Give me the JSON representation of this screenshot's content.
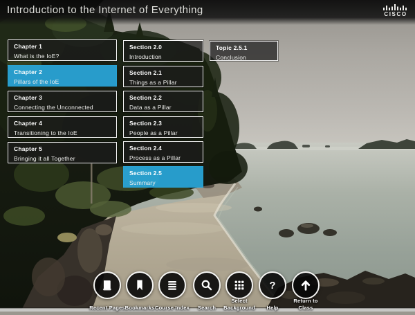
{
  "header": {
    "title": "Introduction to the Internet of Everything",
    "brand": "CISCO"
  },
  "course_menu": {
    "chapters": [
      {
        "label": "Chapter 1",
        "title": "What is the IoE?"
      },
      {
        "label": "Chapter 2",
        "title": "Pillars of the IoE"
      },
      {
        "label": "Chapter 3",
        "title": "Connecting the Unconnected"
      },
      {
        "label": "Chapter 4",
        "title": "Transitioning to the IoE"
      },
      {
        "label": "Chapter 5",
        "title": "Bringing it all Together"
      }
    ],
    "sections": [
      {
        "label": "Section 2.0",
        "title": "Introduction"
      },
      {
        "label": "Section 2.1",
        "title": "Things as a Pillar"
      },
      {
        "label": "Section 2.2",
        "title": "Data as a Pillar"
      },
      {
        "label": "Section 2.3",
        "title": "People as a Pillar"
      },
      {
        "label": "Section 2.4",
        "title": "Process as a Pillar"
      },
      {
        "label": "Section 2.5",
        "title": "Summary"
      }
    ],
    "topics": [
      {
        "label": "Topic 2.5.1",
        "title": "Conclusion"
      }
    ],
    "selected_chapter": "Chapter 2",
    "selected_section": "Section 2.5"
  },
  "toolbar": {
    "buttons": [
      {
        "label": "Recent Pages",
        "icon": "recent-pages-icon"
      },
      {
        "label": "Bookmarks",
        "icon": "bookmarks-icon"
      },
      {
        "label": "Course Index",
        "icon": "course-index-icon"
      },
      {
        "label": "Search",
        "icon": "search-icon"
      },
      {
        "label": "Select Background",
        "icon": "select-background-icon"
      },
      {
        "label": "Help",
        "icon": "help-icon"
      },
      {
        "label": "Return to Class",
        "icon": "return-to-class-icon"
      }
    ]
  },
  "colors": {
    "accent_blue": "#29A7DB",
    "tile_dark": "#1C1C1C",
    "tile_border": "#FFFFFF",
    "toolbar_circle": "#080808"
  }
}
